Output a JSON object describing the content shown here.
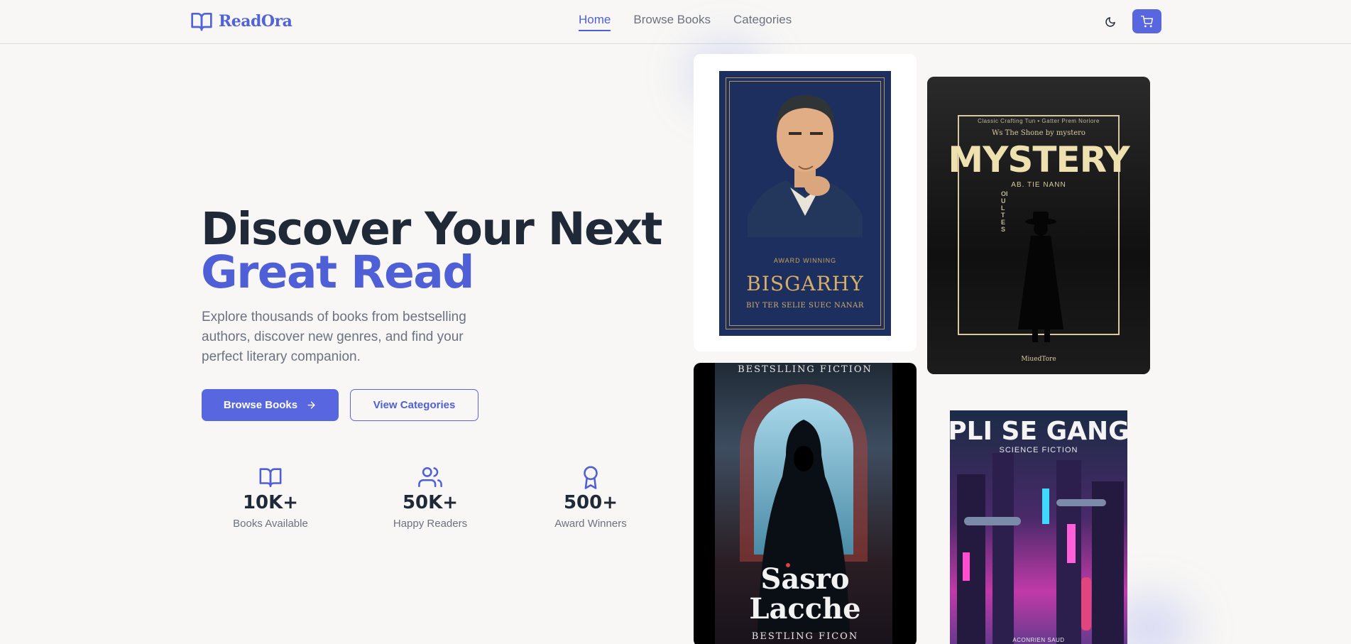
{
  "brand": {
    "name": "ReadOra",
    "accent": "#4f5fd6"
  },
  "nav": {
    "links": [
      {
        "label": "Home",
        "active": true
      },
      {
        "label": "Browse Books",
        "active": false
      },
      {
        "label": "Categories",
        "active": false
      }
    ],
    "theme_icon": "moon-icon",
    "cart_icon": "cart-icon"
  },
  "hero": {
    "title_line1": "Discover Your Next",
    "title_line2": "Great Read",
    "description": "Explore thousands of books from bestselling authors, discover new genres, and find your perfect literary companion.",
    "primary_button": "Browse Books",
    "secondary_button": "View Categories"
  },
  "stats": [
    {
      "icon": "book-open-icon",
      "value": "10K+",
      "label": "Books Available"
    },
    {
      "icon": "users-icon",
      "value": "50K+",
      "label": "Happy Readers"
    },
    {
      "icon": "award-icon",
      "value": "500+",
      "label": "Award Winners"
    }
  ],
  "books": [
    {
      "genre_line": "AWARD WINNING",
      "title": "BISGARHY",
      "author": "BIY TER SELIE SUEC NANAR"
    },
    {
      "top_line": "Classic Crafting Tun • Gatter Prem Noriore",
      "subtitle": "Ws The Shone by mystero",
      "title": "MYSTERY",
      "author": "AB. TIE NANN",
      "side_text": "OIULTES",
      "publisher": "MiuedTore"
    },
    {
      "top_line": "BESTSLLING FICTION",
      "title_line1": "Sasro",
      "title_line2": "Lacche",
      "bottom_line": "BESTLING FICON"
    },
    {
      "title": "PLI SE GANG",
      "subtitle": "SCIENCE FICTION",
      "author": "ACONRIEN SAUD"
    }
  ]
}
